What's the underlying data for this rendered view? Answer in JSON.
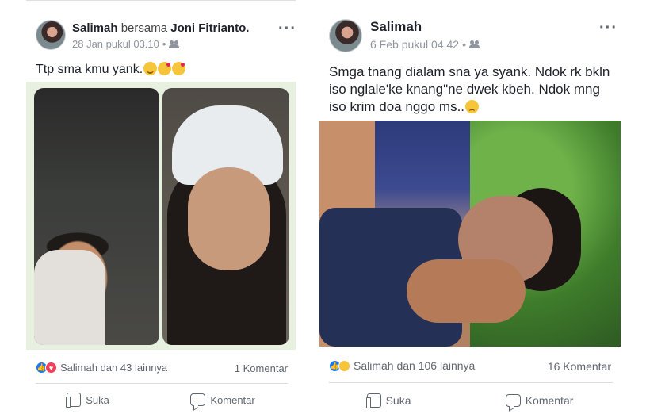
{
  "posts": [
    {
      "author": "Salimah",
      "with_text": "bersama",
      "tagged": "Joni Fitrianto",
      "tagged_suffix": ".",
      "date": "28 Jan pukul 03.10",
      "privacy_icon": "friends-icon",
      "more": "···",
      "text": "Ttp sma kmu yank.",
      "emojis": [
        "blush-emoji",
        "kiss-emoji",
        "kiss-emoji"
      ],
      "reactions_text": "Salimah dan 43 lainnya",
      "reaction_icons": [
        "like-icon",
        "love-icon"
      ],
      "comments": "1 Komentar",
      "like_label": "Suka",
      "comment_label": "Komentar"
    },
    {
      "author": "Salimah",
      "date": "6 Feb pukul 04.42",
      "privacy_icon": "friends-icon",
      "more": "···",
      "text": "Smga tnang dialam sna ya syank. Ndok rk bkln iso nglale'ke knang\"ne dwek kbeh. Ndok mng iso krim doa nggo ms..",
      "emojis": [
        "sad-emoji"
      ],
      "reactions_text": "Salimah dan 106 lainnya",
      "reaction_icons": [
        "like-icon",
        "sad-icon"
      ],
      "comments": "16 Komentar",
      "like_label": "Suka",
      "comment_label": "Komentar"
    }
  ],
  "colors": {
    "like": "#1877f2",
    "love": "#f33e58",
    "sad": "#f7c53b",
    "muted": "#90949c"
  }
}
